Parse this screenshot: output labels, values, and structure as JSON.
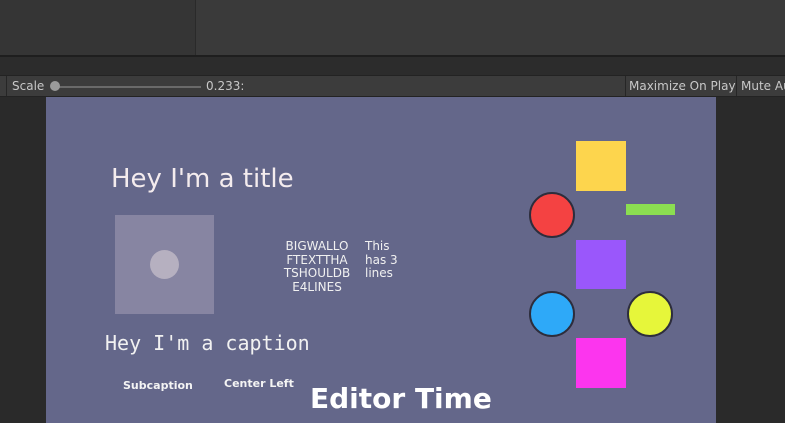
{
  "toolbar": {
    "scale_label": "Scale",
    "scale_value": "0.233:",
    "maximize_label": "Maximize On Play",
    "mute_label": "Mute Au"
  },
  "game": {
    "title": "Hey I'm a title",
    "wrap_lines": [
      "BIGWALLO",
      "FTEXTTHA",
      "TSHOULDB",
      "E4LINES"
    ],
    "three_lines": [
      "This",
      "has 3",
      "lines"
    ],
    "caption": "Hey I'm a caption",
    "subcaption": "Subcaption",
    "center_left": "Center Left",
    "editor_time": "Editor Time"
  },
  "colors": {
    "canvas_bg": "#64678a",
    "yellow_square": "#fdd54d",
    "green_bar": "#8bde51",
    "red_circle": "#f44242",
    "purple_square": "#9a57fb",
    "blue_circle": "#2ea9f8",
    "lime_circle": "#e6f63a",
    "magenta_square": "#fc35ee"
  }
}
